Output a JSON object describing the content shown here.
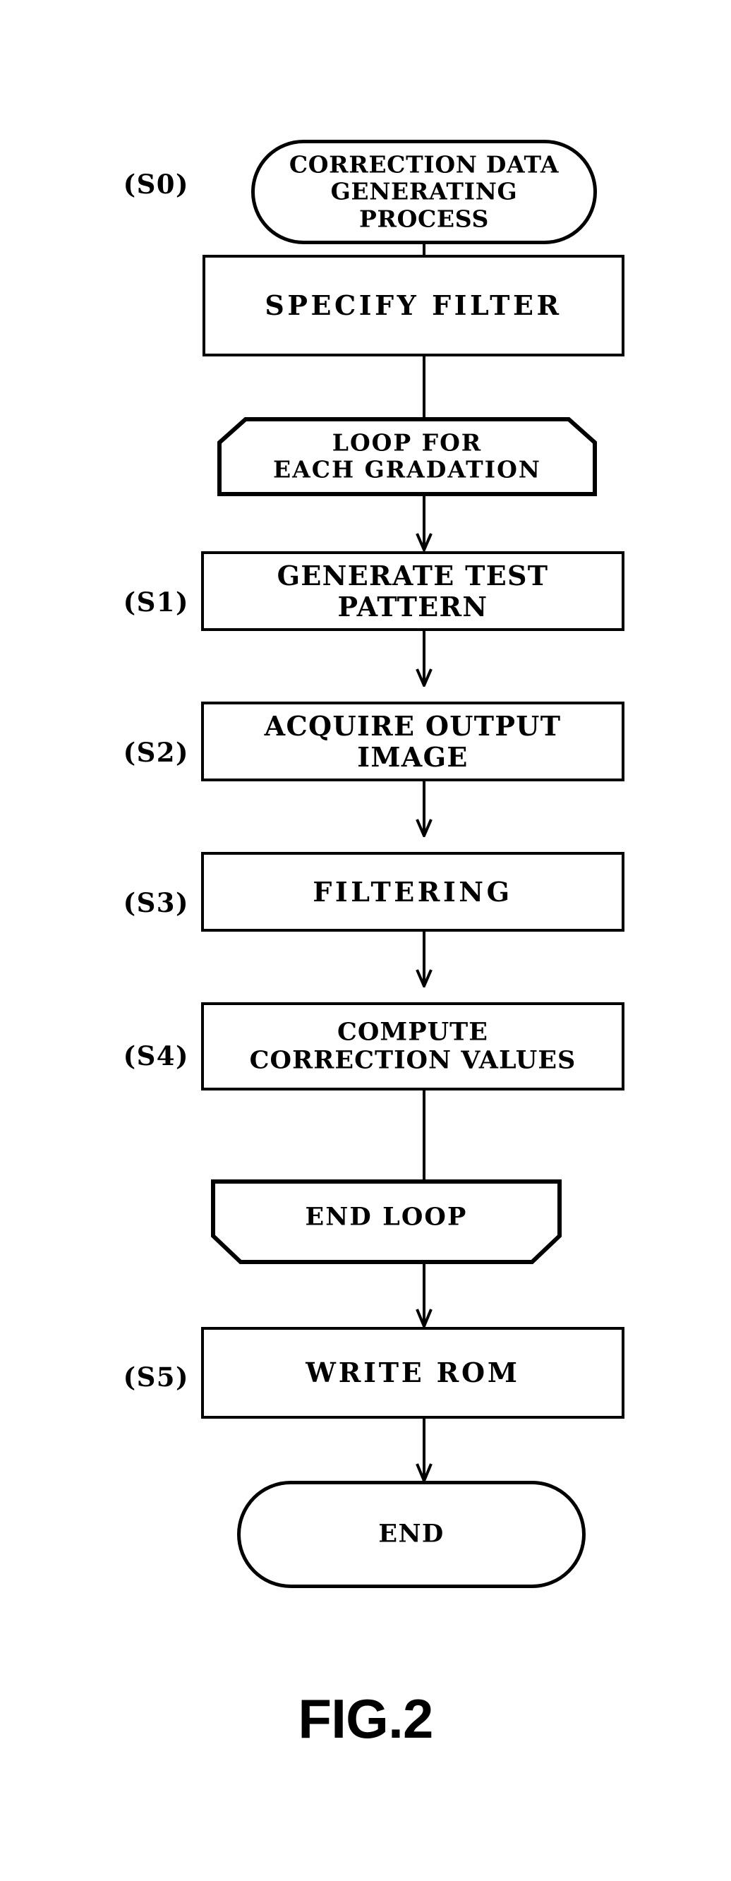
{
  "figure": {
    "caption": "FIG.2",
    "title": "CORRECTION DATA GENERATING PROCESS",
    "type": "flowchart"
  },
  "flowchart": {
    "nodes": [
      {
        "id": "start",
        "shape": "terminator",
        "step": "",
        "text": "CORRECTION DATA\nGENERATING\nPROCESS"
      },
      {
        "id": "s0",
        "shape": "process",
        "step": "(S0)",
        "text": "SPECIFY FILTER"
      },
      {
        "id": "loop-start",
        "shape": "loop-start",
        "step": "",
        "text": "LOOP FOR\nEACH GRADATION"
      },
      {
        "id": "s1",
        "shape": "process",
        "step": "(S1)",
        "text": "GENERATE TEST PATTERN"
      },
      {
        "id": "s2",
        "shape": "process",
        "step": "(S2)",
        "text": "ACQUIRE OUTPUT IMAGE"
      },
      {
        "id": "s3",
        "shape": "process",
        "step": "(S3)",
        "text": "FILTERING"
      },
      {
        "id": "s4",
        "shape": "process",
        "step": "(S4)",
        "text": "COMPUTE\nCORRECTION VALUES"
      },
      {
        "id": "loop-end",
        "shape": "loop-end",
        "step": "",
        "text": "END LOOP"
      },
      {
        "id": "s5",
        "shape": "process",
        "step": "(S5)",
        "text": "WRITE ROM"
      },
      {
        "id": "end",
        "shape": "terminator",
        "step": "",
        "text": "END"
      }
    ],
    "edges": [
      {
        "from": "start",
        "to": "s0",
        "arrow": true
      },
      {
        "from": "s0",
        "to": "loop-start",
        "arrow": false
      },
      {
        "from": "loop-start",
        "to": "s1",
        "arrow": true
      },
      {
        "from": "s1",
        "to": "s2",
        "arrow": true
      },
      {
        "from": "s2",
        "to": "s3",
        "arrow": true
      },
      {
        "from": "s3",
        "to": "s4",
        "arrow": true
      },
      {
        "from": "s4",
        "to": "loop-end",
        "arrow": false
      },
      {
        "from": "loop-end",
        "to": "s5",
        "arrow": true
      },
      {
        "from": "s5",
        "to": "end",
        "arrow": true
      }
    ]
  },
  "colors": {
    "ink": "#000000",
    "paper": "#ffffff"
  }
}
